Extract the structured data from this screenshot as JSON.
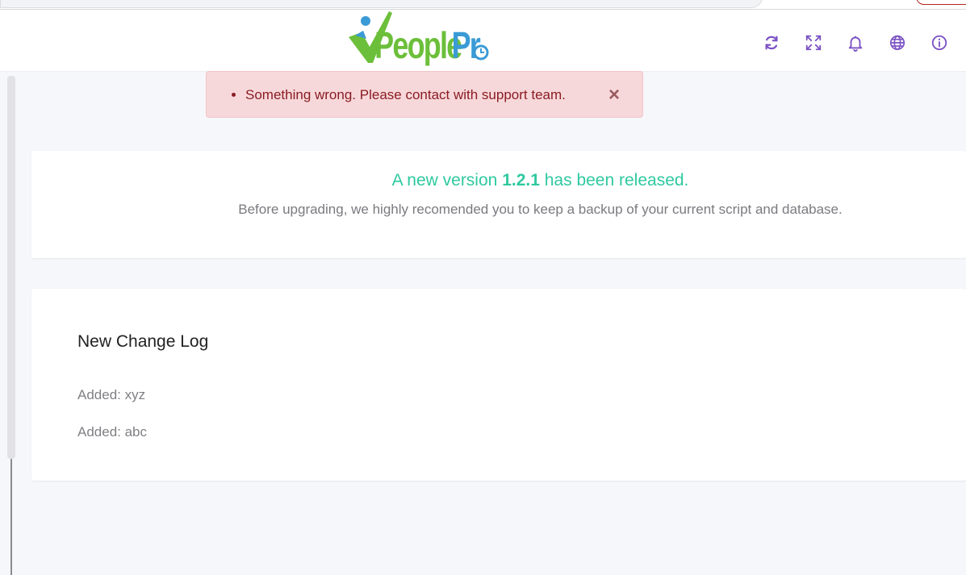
{
  "header": {
    "brand": "PeoplePro",
    "icons": [
      "refresh-icon",
      "fullscreen-icon",
      "bell-icon",
      "globe-icon",
      "info-icon"
    ]
  },
  "alert": {
    "message": "Something wrong. Please contact with support team.",
    "close_label": "×"
  },
  "version_card": {
    "prefix": "A new version",
    "version": "1.2.1",
    "suffix": "has been released.",
    "note": "Before upgrading, we highly recomended you to keep a backup of your current script and database."
  },
  "changelog": {
    "title": "New Change Log",
    "items": [
      "Added: xyz",
      "Added: abc"
    ]
  },
  "colors": {
    "accent": "#7b52c4",
    "success_text": "#2fc9a0",
    "alert_bg": "#f7d8da",
    "alert_text": "#8a1c23"
  }
}
